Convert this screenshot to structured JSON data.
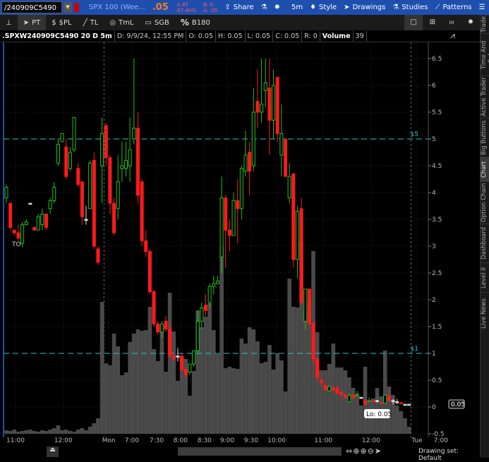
{
  "header": {
    "symbol": "/240909C5490",
    "description": "SPX 100 (Wee...",
    "last": ".05",
    "change": "-1.87",
    "change_pct": "-97.40%",
    "bid": "B: 0",
    "ask": "A: .05",
    "buttons": [
      {
        "label": "Share",
        "icon": "share-icon"
      },
      {
        "label": "",
        "icon": "flask-icon"
      },
      {
        "label": "",
        "icon": "gear-icon"
      },
      {
        "label": "5m",
        "icon": ""
      },
      {
        "label": "Style",
        "icon": "style-icon"
      },
      {
        "label": "Drawings",
        "icon": "cursor-icon"
      },
      {
        "label": "Studies",
        "icon": "flask-icon"
      },
      {
        "label": "Patterns",
        "icon": "patterns-icon"
      }
    ]
  },
  "toolbar": {
    "tools": [
      {
        "label": "",
        "icon": "pin-icon"
      },
      {
        "label": "PT",
        "icon": "pointer-icon"
      },
      {
        "label": "$PL",
        "icon": "dollar-icon"
      },
      {
        "label": "TL",
        "icon": "trendline-icon"
      },
      {
        "label": "TmL",
        "icon": "timeline-icon"
      },
      {
        "label": "SGB",
        "icon": "rectangle-icon"
      },
      {
        "label": "B180",
        "icon": "percent-icon"
      }
    ]
  },
  "info": {
    "symbol": ".SPXW240909C5490 20 D 5m",
    "date": "D: 9/9/24, 12:55 PM",
    "open": "O: 0.05",
    "high": "H: 0.05",
    "low": "L: 0.05",
    "close": "C: 0.05",
    "range": "R: 0",
    "volume_label": "Volume",
    "volume": "39"
  },
  "colors": {
    "up": "#22c01e",
    "down": "#ff1a1a",
    "level": "#27c3c8",
    "volume": "#4a4a4a",
    "topbar": "#1f4fae"
  },
  "chart_data": {
    "type": "candlestick",
    "ylim": [
      -0.5,
      6.6
    ],
    "yticks": [
      "6.5",
      "6",
      "5.5",
      "5",
      "4.5",
      "4",
      "3.5",
      "3",
      "2.5",
      "2",
      "1.5",
      "1",
      "0.5",
      "0",
      "-0.5"
    ],
    "levels": [
      {
        "price": 5,
        "label": "$5"
      },
      {
        "price": 1,
        "label": "$1"
      }
    ],
    "last_price_tag": "0.05",
    "tooltip": "Lo: 0.05",
    "annotation": "TO",
    "xticks": [
      {
        "label": "11:00",
        "bar": 2.3
      },
      {
        "label": "12:00",
        "bar": 14.3
      },
      {
        "label": "Mon",
        "bar": 25.7
      },
      {
        "label": "7:00",
        "bar": 31.5
      },
      {
        "label": "7:30",
        "bar": 37.7
      },
      {
        "label": "8:00",
        "bar": 43.7
      },
      {
        "label": "8:30",
        "bar": 49.7
      },
      {
        "label": "9:00",
        "bar": 55.4
      },
      {
        "label": "9:30",
        "bar": 61.4
      },
      {
        "label": "10:00",
        "bar": 67.8
      },
      {
        "label": "11:00",
        "bar": 79.5
      },
      {
        "label": "12:00",
        "bar": 91.5
      },
      {
        "label": "Tue",
        "bar": 103
      },
      {
        "label": "7:00",
        "bar": 109
      }
    ],
    "session_breaks": [
      24.5,
      101.5
    ],
    "ohlc": [
      [
        3.9,
        4.15,
        3.8,
        4.1
      ],
      [
        3.8,
        3.8,
        3.3,
        3.35
      ],
      [
        3.3,
        3.3,
        3.2,
        3.25
      ],
      [
        3.25,
        3.4,
        3.1,
        3.15
      ],
      [
        3.05,
        3.45,
        2.98,
        3.4
      ],
      [
        3.4,
        3.5,
        3.4,
        3.45
      ],
      [
        3.8,
        3.8,
        3.8,
        3.8
      ],
      [
        3.35,
        3.35,
        3.3,
        3.3
      ],
      [
        3.3,
        3.6,
        3.3,
        3.55
      ],
      [
        3.4,
        3.7,
        3.3,
        3.6
      ],
      [
        3.6,
        3.6,
        3.3,
        3.35
      ],
      [
        3.7,
        3.9,
        3.6,
        3.85
      ],
      [
        3.85,
        4.2,
        3.8,
        4.1
      ],
      [
        4.55,
        5.0,
        4.5,
        4.9
      ],
      [
        4.95,
        5.1,
        4.95,
        5.1
      ],
      [
        4.85,
        5.0,
        4.25,
        4.3
      ],
      [
        4.45,
        4.85,
        4.4,
        4.75
      ],
      [
        4.8,
        5.4,
        4.75,
        5.4
      ],
      [
        4.45,
        4.55,
        4.1,
        4.15
      ],
      [
        4.2,
        4.2,
        3.4,
        3.55
      ],
      [
        3.5,
        3.75,
        3.4,
        3.5
      ],
      [
        3.7,
        4.6,
        3.7,
        4.55
      ],
      [
        4.6,
        4.75,
        2.95,
        3.0
      ],
      [
        2.95,
        3.0,
        2.65,
        2.7
      ],
      [
        4.5,
        5.4,
        3.8,
        5.1
      ],
      [
        5.25,
        5.3,
        4.5,
        4.65
      ],
      [
        4.65,
        4.7,
        3.6,
        3.8
      ],
      [
        3.8,
        3.9,
        3.2,
        3.25
      ],
      [
        3.7,
        4.7,
        3.5,
        4.2
      ],
      [
        4.45,
        4.95,
        4.2,
        4.5
      ],
      [
        4.45,
        4.95,
        4.3,
        4.6
      ],
      [
        4.5,
        5.4,
        4.2,
        4.8
      ],
      [
        5.0,
        6.5,
        4.9,
        5.2
      ],
      [
        5.2,
        5.5,
        3.8,
        3.95
      ],
      [
        4.2,
        4.25,
        3.0,
        3.1
      ],
      [
        3.1,
        3.3,
        2.8,
        2.9
      ],
      [
        2.9,
        2.95,
        2.1,
        2.15
      ],
      [
        2.15,
        2.2,
        1.5,
        1.55
      ],
      [
        1.55,
        1.6,
        1.35,
        1.4
      ],
      [
        1.4,
        1.6,
        1.3,
        1.55
      ],
      [
        1.6,
        1.7,
        1.4,
        1.45
      ],
      [
        1.45,
        1.6,
        0.9,
        0.95
      ],
      [
        0.95,
        1.0,
        0.85,
        0.9
      ],
      [
        0.95,
        1.1,
        0.85,
        0.95
      ],
      [
        0.95,
        1.0,
        0.65,
        0.7
      ],
      [
        0.7,
        0.75,
        0.55,
        0.6
      ],
      [
        0.65,
        0.8,
        0.6,
        0.8
      ],
      [
        0.8,
        1.0,
        0.75,
        1.05
      ],
      [
        1.05,
        1.8,
        1.0,
        1.6
      ],
      [
        1.6,
        1.95,
        1.45,
        1.85
      ],
      [
        1.9,
        2.1,
        1.7,
        1.8
      ],
      [
        1.95,
        2.3,
        1.85,
        2.25
      ],
      [
        2.25,
        2.45,
        2.1,
        2.3
      ],
      [
        2.3,
        2.45,
        2.3,
        2.35
      ],
      [
        2.8,
        4.3,
        2.5,
        3.9
      ],
      [
        3.9,
        3.95,
        2.6,
        3.3
      ],
      [
        3.3,
        3.5,
        2.9,
        3.2
      ],
      [
        3.2,
        4.0,
        3.2,
        3.85
      ],
      [
        3.85,
        4.25,
        3.05,
        3.7
      ],
      [
        3.7,
        4.5,
        3.5,
        4.45
      ],
      [
        4.4,
        5.15,
        4.3,
        4.7
      ],
      [
        4.75,
        4.95,
        3.95,
        4.4
      ],
      [
        4.5,
        5.95,
        4.4,
        5.5
      ],
      [
        5.7,
        6.3,
        5.2,
        5.5
      ],
      [
        5.5,
        6.5,
        5.3,
        5.65
      ],
      [
        5.9,
        6.5,
        5.6,
        6.05
      ],
      [
        5.95,
        6.5,
        4.7,
        5.35
      ],
      [
        5.35,
        6.3,
        5.0,
        6.0
      ],
      [
        6.15,
        6.15,
        4.95,
        5.1
      ],
      [
        4.7,
        5.65,
        4.3,
        5.1
      ],
      [
        5.0,
        5.0,
        4.3,
        4.3
      ],
      [
        3.9,
        4.55,
        3.8,
        4.3
      ],
      [
        4.35,
        4.35,
        2.6,
        2.75
      ],
      [
        2.75,
        3.75,
        2.4,
        3.65
      ],
      [
        3.7,
        3.9,
        1.9,
        1.95
      ],
      [
        1.6,
        2.1,
        1.45,
        2.2
      ],
      [
        2.2,
        2.2,
        1.5,
        1.55
      ],
      [
        1.55,
        1.6,
        0.8,
        0.9
      ],
      [
        0.9,
        0.9,
        0.5,
        0.55
      ],
      [
        0.5,
        0.55,
        0.4,
        0.45
      ],
      [
        0.4,
        0.45,
        0.3,
        0.32
      ],
      [
        0.3,
        0.4,
        0.3,
        0.38
      ],
      [
        0.35,
        0.4,
        0.3,
        0.32
      ],
      [
        0.35,
        0.4,
        0.25,
        0.25
      ],
      [
        0.27,
        0.3,
        0.22,
        0.23
      ],
      [
        0.22,
        0.25,
        0.15,
        0.17
      ],
      [
        0.1,
        0.25,
        0.1,
        0.22
      ],
      [
        0.22,
        0.25,
        0.15,
        0.17
      ],
      [
        0.2,
        0.3,
        0.2,
        0.22
      ],
      [
        0.18,
        0.18,
        0.18,
        0.18
      ],
      [
        0.12,
        0.15,
        0.05,
        0.05
      ],
      [
        0.1,
        0.18,
        0.1,
        0.12
      ],
      [
        0.12,
        0.14,
        0.1,
        0.1
      ],
      [
        0.12,
        0.13,
        0.08,
        0.12
      ],
      [
        0.08,
        0.1,
        0.07,
        0.07
      ],
      [
        0.07,
        0.2,
        0.07,
        0.22
      ],
      [
        0.2,
        0.3,
        0.1,
        0.12
      ],
      [
        0.12,
        0.15,
        0.05,
        0.12
      ],
      [
        0.1,
        0.15,
        0.05,
        0.1
      ],
      [
        0.08,
        0.08,
        0.07,
        0.07
      ],
      [
        0.05,
        0.05,
        0.05,
        0.05
      ],
      [
        0.05,
        0.05,
        0.05,
        0.05
      ]
    ],
    "volume": [
      5,
      4,
      6,
      3,
      4,
      5,
      6,
      4,
      3,
      5,
      4,
      6,
      8,
      12,
      5,
      6,
      4,
      3,
      6,
      8,
      5,
      10,
      15,
      22,
      187,
      100,
      97,
      142,
      124,
      83,
      87,
      130,
      142,
      148,
      146,
      147,
      180,
      120,
      103,
      152,
      88,
      200,
      145,
      75,
      110,
      106,
      54,
      89,
      175,
      151,
      166,
      185,
      147,
      113,
      265,
      93,
      95,
      93,
      92,
      135,
      128,
      151,
      148,
      131,
      100,
      102,
      126,
      91,
      114,
      104,
      60,
      220,
      180,
      179,
      272,
      170,
      187,
      259,
      144,
      90,
      90,
      99,
      128,
      94,
      94,
      90,
      80,
      65,
      57,
      40,
      95,
      47,
      50,
      65,
      53,
      118,
      67,
      55,
      40,
      32,
      22,
      10
    ]
  },
  "x_nav": {
    "drawing_set": "Drawing set: Default"
  },
  "side_tabs": [
    "Trade",
    "Time And Sales",
    "Active Trader",
    "Big Buttons",
    "Chart",
    "Option Chain",
    "Dashboard",
    "Level II",
    "Live News"
  ]
}
